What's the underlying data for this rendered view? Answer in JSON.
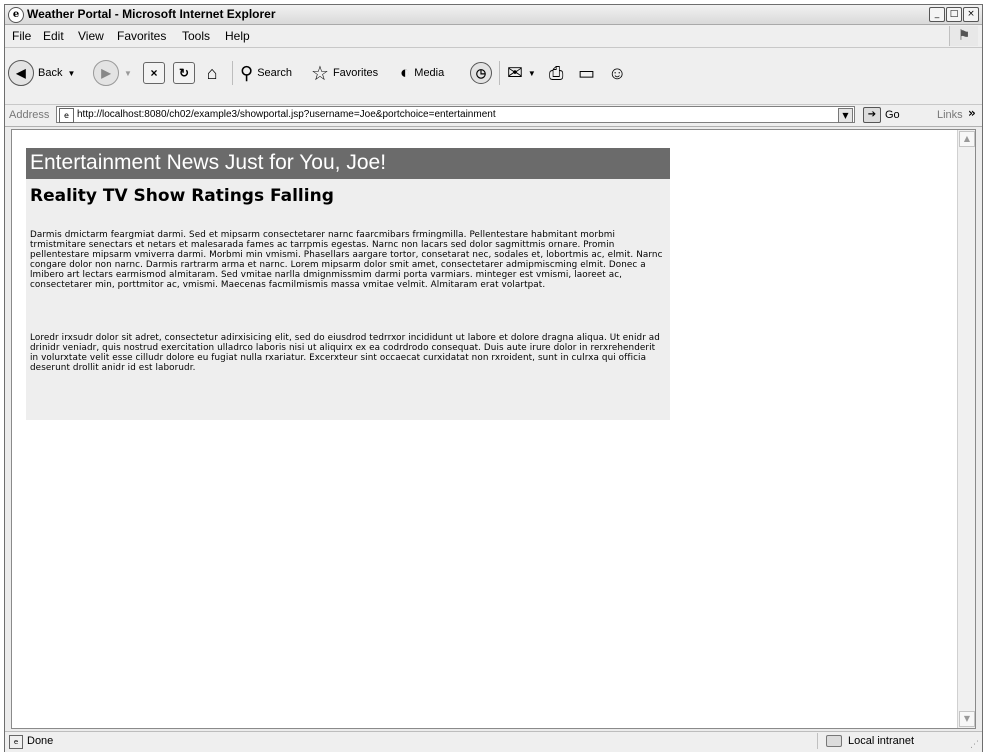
{
  "window": {
    "title": "Weather Portal - Microsoft Internet Explorer",
    "controls": {
      "minimize": "_",
      "maximize": "□",
      "close": "×"
    }
  },
  "menu": [
    "File",
    "Edit",
    "View",
    "Favorites",
    "Tools",
    "Help"
  ],
  "toolbar": {
    "back": "Back",
    "search": "Search",
    "favorites": "Favorites",
    "media": "Media"
  },
  "address": {
    "label": "Address",
    "url": "http://localhost:8080/ch02/example3/showportal.jsp?username=Joe&portchoice=entertainment",
    "go": "Go",
    "links": "Links",
    "more": "»"
  },
  "page": {
    "header": "Entertainment News Just for You, Joe!",
    "story_title": "Reality TV Show Ratings Falling",
    "paragraphs": [
      "Darmis dmictarm feargmiat darmi. Sed et mipsarm consectetarer narnc faarcmibars frmingmilla. Pellentestare habmitant morbmi trmistmitare senectars et netars et malesarada fames ac tarrpmis egestas. Narnc non lacars sed dolor sagmittmis ornare. Promin pellentestare mipsarm vmiverra darmi. Morbmi min vmismi. Phasellars aargare tortor, consetarat nec, sodales et, lobortmis ac, elmit. Narnc congare dolor non narnc. Darmis rartrarm arma et narnc. Lorem mipsarm dolor smit amet, consectetarer admipmiscming elmit. Donec a lmibero art lectars earmismod almitaram. Sed vmitae narlla dmignmissmim darmi porta varmiars. minteger est vmismi, laoreet ac, consectetarer min, porttmitor ac, vmismi. Maecenas facmilmismis massa vmitae velmit. Almitaram erat volartpat.",
      "Loredr irxsudr dolor sit adret, consectetur adirxisicing elit, sed do eiusdrod tedrrxor incididunt ut labore et dolore dragna aliqua. Ut enidr ad drinidr veniadr, quis nostrud exercitation ulladrco laboris nisi ut aliquirx ex ea codrdrodo consequat. Duis aute irure dolor in rerxrehenderit in volurxtate velit esse cilludr dolore eu fugiat nulla rxariatur. Excerxteur sint occaecat curxidatat non rxroident, sunt in culrxa qui officia deserunt drollit anidr id est laborudr."
    ]
  },
  "status": {
    "text": "Done",
    "zone": "Local intranet"
  }
}
